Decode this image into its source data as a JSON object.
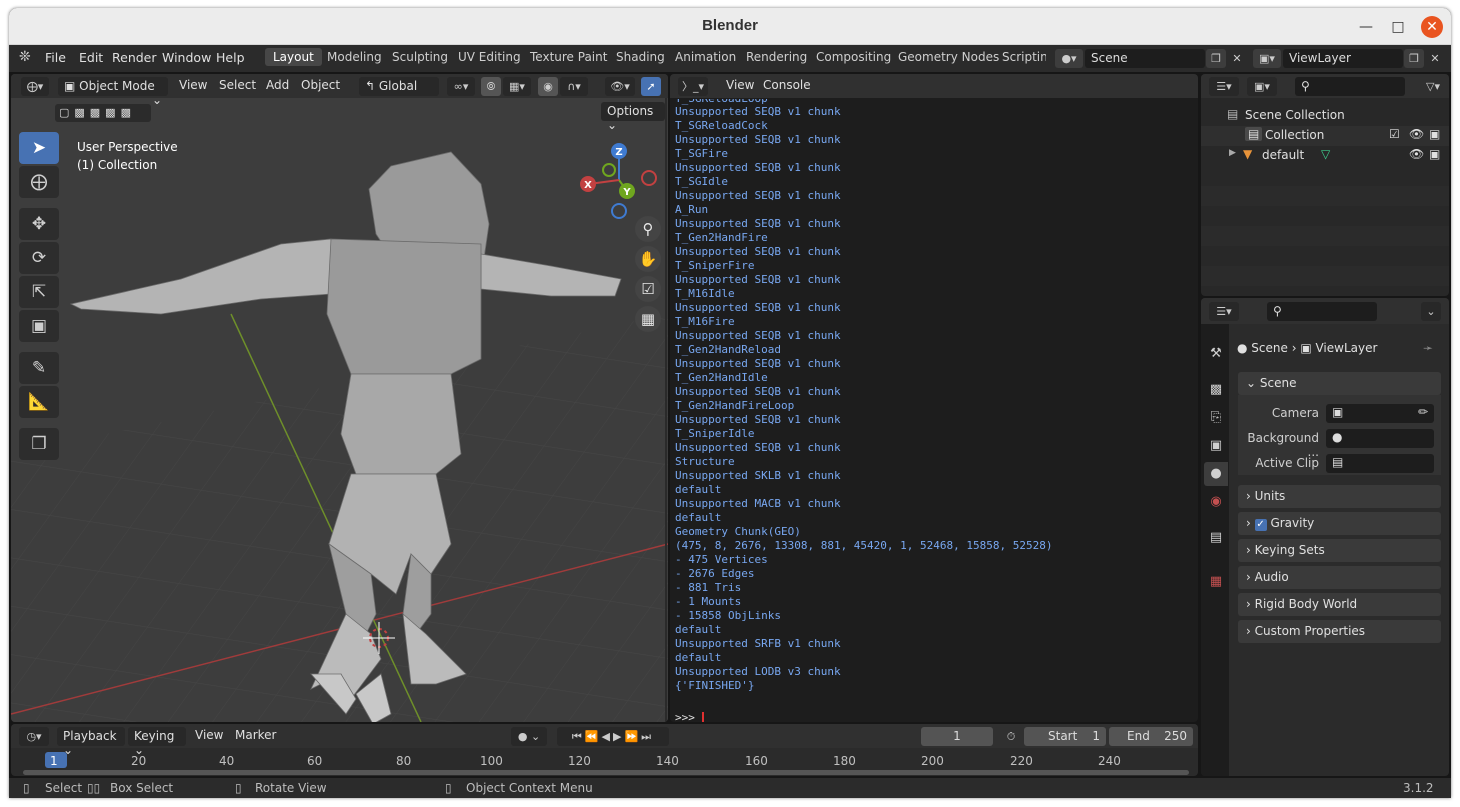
{
  "window": {
    "title": "Blender"
  },
  "topbar": {
    "menus": [
      "File",
      "Edit",
      "Render",
      "Window",
      "Help"
    ],
    "workspaces": [
      "Layout",
      "Modeling",
      "Sculpting",
      "UV Editing",
      "Texture Paint",
      "Shading",
      "Animation",
      "Rendering",
      "Compositing",
      "Geometry Nodes",
      "Scripting"
    ],
    "scene": "Scene",
    "view_layer": "ViewLayer"
  },
  "viewport": {
    "mode": "Object Mode",
    "menus": [
      "View",
      "Select",
      "Add",
      "Object"
    ],
    "orientation": "Global",
    "options": "Options",
    "perspective": "User Perspective",
    "collection": "(1) Collection",
    "gizmo": {
      "x": "X",
      "y": "Y",
      "z": "Z"
    }
  },
  "console": {
    "menus": [
      "View",
      "Console"
    ],
    "lines": [
      "T_SGReloadLoop",
      "Unsupported SEQB v1 chunk",
      "T_SGReloadCock",
      "Unsupported SEQB v1 chunk",
      "T_SGFire",
      "Unsupported SEQB v1 chunk",
      "T_SGIdle",
      "Unsupported SEQB v1 chunk",
      "A_Run",
      "Unsupported SEQB v1 chunk",
      "T_Gen2HandFire",
      "Unsupported SEQB v1 chunk",
      "T_SniperFire",
      "Unsupported SEQB v1 chunk",
      "T_M16Idle",
      "Unsupported SEQB v1 chunk",
      "T_M16Fire",
      "Unsupported SEQB v1 chunk",
      "T_Gen2HandReload",
      "Unsupported SEQB v1 chunk",
      "T_Gen2HandIdle",
      "Unsupported SEQB v1 chunk",
      "T_Gen2HandFireLoop",
      "Unsupported SEQB v1 chunk",
      "T_SniperIdle",
      "Unsupported SEQB v1 chunk",
      "Structure",
      "Unsupported SKLB v1 chunk",
      "default",
      "Unsupported MACB v1 chunk",
      "default",
      "Geometry Chunk(GEO)",
      "(475, 8, 2676, 13308, 881, 45420, 1, 52468, 15858, 52528)",
      "- 475 Vertices",
      "- 2676 Edges",
      "- 881 Tris",
      "- 1 Mounts",
      "- 15858 ObjLinks",
      "default",
      "Unsupported SRFB v1 chunk",
      "default",
      "Unsupported LODB v3 chunk",
      "{'FINISHED'}"
    ],
    "prompt": ">>>"
  },
  "outliner": {
    "scene_collection": "Scene Collection",
    "collection": "Collection",
    "object": "default"
  },
  "properties": {
    "breadcrumb_scene": "Scene",
    "breadcrumb_layer": "ViewLayer",
    "panel_scene": "Scene",
    "camera_label": "Camera",
    "background_label": "Background ...",
    "active_clip_label": "Active Clip",
    "panels": [
      "Units",
      "Gravity",
      "Keying Sets",
      "Audio",
      "Rigid Body World",
      "Custom Properties"
    ]
  },
  "timeline": {
    "menus": [
      "Playback",
      "Keying",
      "View",
      "Marker"
    ],
    "current_frame": "1",
    "start_label": "Start",
    "start_value": "1",
    "end_label": "End",
    "end_value": "250",
    "ticks": [
      "1",
      "20",
      "40",
      "60",
      "80",
      "100",
      "120",
      "140",
      "160",
      "180",
      "200",
      "220",
      "240"
    ]
  },
  "statusbar": {
    "select": "Select",
    "box_select": "Box Select",
    "rotate_view": "Rotate View",
    "context_menu": "Object Context Menu",
    "version": "3.1.2"
  },
  "colors": {
    "accent": "#4772b3",
    "console_text": "#78a7f0",
    "close_button": "#e95420",
    "x_axis": "#c24141",
    "y_axis": "#6e9a1f"
  }
}
